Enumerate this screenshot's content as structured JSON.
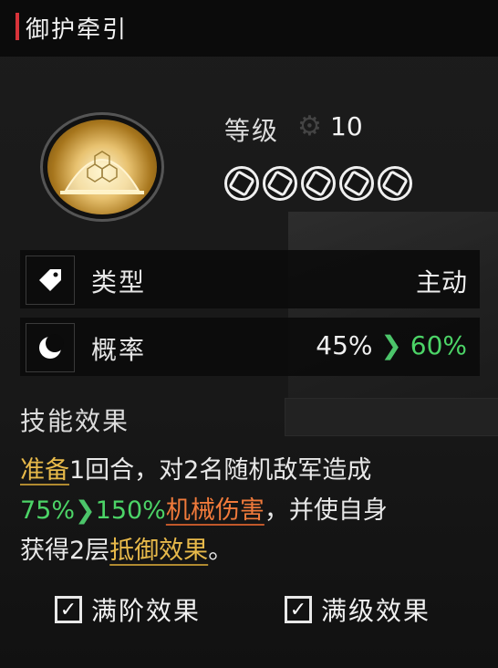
{
  "title": "御护牵引",
  "icon": "dome-shield-icon",
  "level": {
    "label": "等级",
    "value": "10",
    "stars": 5
  },
  "type_row": {
    "icon": "tag-icon",
    "label": "类型",
    "value": "主动"
  },
  "rate_row": {
    "icon": "moon-icon",
    "label": "概率",
    "from": "45%",
    "to": "60%"
  },
  "effect": {
    "title": "技能效果",
    "line1_kw": "准备",
    "line1_rest": "1回合，对2名随机敌军造成",
    "line2_from": "75%",
    "line2_to": "150%",
    "line2_kw": "机械伤害",
    "line2_rest": "，并使自身",
    "line3_pre": "获得2层",
    "line3_kw": "抵御效果",
    "line3_post": "。"
  },
  "toggles": [
    {
      "label": "满阶效果",
      "checked": true
    },
    {
      "label": "满级效果",
      "checked": true
    }
  ],
  "colors": {
    "accent_red": "#d8333a",
    "green": "#4cd467",
    "yellow": "#e7b94a",
    "orange": "#f07a3b"
  }
}
